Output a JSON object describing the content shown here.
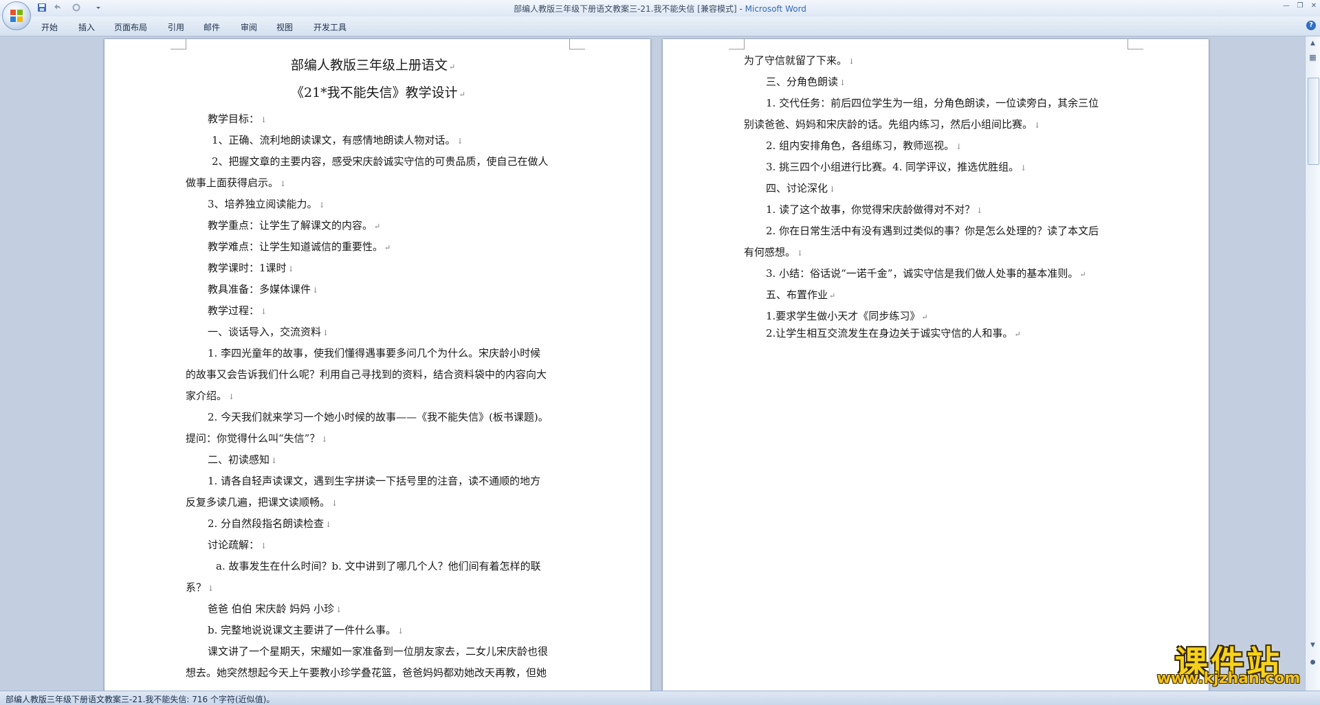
{
  "window": {
    "title": "部编人教版三年级下册语文教案三-21.我不能失信 [兼容模式] - ",
    "app_name": "Microsoft Word"
  },
  "ribbon": {
    "tabs": [
      "开始",
      "插入",
      "页面布局",
      "引用",
      "邮件",
      "审阅",
      "视图",
      "开发工具"
    ]
  },
  "page1": {
    "title1": "部编人教版三年级上册语文",
    "title2": "《21*我不能失信》教学设计",
    "lines": [
      "教学目标：",
      "1、正确、流利地朗读课文，有感情地朗读人物对话。",
      "2、把握文章的主要内容，感受宋庆龄诚实守信的可贵品质，使自己在做人",
      "做事上面获得启示。",
      "3、培养独立阅读能力。",
      "教学重点：让学生了解课文的内容。",
      "教学难点：让学生知道诚信的重要性。",
      "教学课时：1课时",
      "教具准备：多媒体课件",
      "教学过程：",
      "一、谈话导入，交流资料",
      "1. 李四光童年的故事，使我们懂得遇事要多问几个为什么。宋庆龄小时候",
      "的故事又会告诉我们什么呢？利用自己寻找到的资料，结合资料袋中的内容向大",
      "家介绍。",
      "2. 今天我们就来学习一个她小时候的故事——《我不能失信》(板书课题)。",
      "提问：你觉得什么叫“失信”？",
      "二、初读感知",
      "1. 请各自轻声读课文，遇到生字拼读一下括号里的注音，读不通顺的地方",
      "反复多读几遍，把课文读顺畅。",
      "2. 分自然段指名朗读检查",
      "讨论疏解：",
      "a. 故事发生在什么时间？b. 文中讲到了哪几个人？他们间有着怎样的联",
      "系？",
      "爸爸   伯伯   宋庆龄   妈妈   小珍",
      "b. 完整地说说课文主要讲了一件什么事。",
      "课文讲了一个星期天，宋耀如一家准备到一位朋友家去，二女儿宋庆龄也很",
      "想去。她突然想起今天上午要教小珍学叠花篮，爸爸妈妈都劝她改天再教，但她"
    ]
  },
  "page2": {
    "lines": [
      "为了守信就留了下来。",
      "三、分角色朗读",
      "1. 交代任务：前后四位学生为一组，分角色朗读，一位读旁白，其余三位",
      "别读爸爸、妈妈和宋庆龄的话。先组内练习，然后小组间比赛。",
      "2. 组内安排角色，各组练习，教师巡视。",
      "3. 挑三四个小组进行比赛。4. 同学评议，推选优胜组。",
      "四、讨论深化",
      "1. 读了这个故事，你觉得宋庆龄做得对不对？",
      "2. 你在日常生活中有没有遇到过类似的事？你是怎么处理的？读了本文后",
      "有何感想。",
      "3. 小结：俗话说“一诺千金”，诚实守信是我们做人处事的基本准则。",
      "五、布置作业",
      "1.要求学生做小天才《同步练习》",
      "2.让学生相互交流发生在身边关于诚实守信的人和事。"
    ]
  },
  "statusbar": {
    "text": "部编人教版三年级下册语文教案三-21.我不能失信: 716 个字符(近似值)。"
  },
  "watermark": {
    "main": "课件站",
    "url": "www.kjzhan.com"
  },
  "colors": {
    "app_name": "#3468b5",
    "doc_background": "#c3cfe0",
    "watermark": "#f6d21a"
  },
  "icons": [
    "office-button-icon",
    "save-icon",
    "undo-icon",
    "redo-icon",
    "customize-toolbar-icon",
    "minimize-icon",
    "maximize-icon",
    "close-icon",
    "help-icon",
    "scroll-up-icon",
    "scroll-down-icon",
    "ruler-toggle-icon",
    "browse-object-icon"
  ]
}
